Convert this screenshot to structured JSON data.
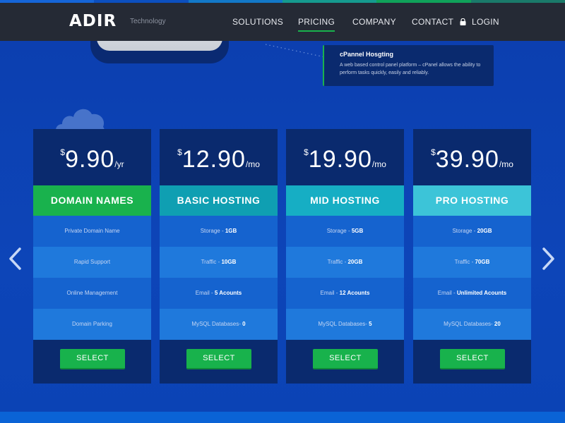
{
  "colors": {
    "accent_green": "#19b24d",
    "header_bg": "#252a35",
    "page_bg": "#0d47b8",
    "card_dark": "#0a2a6e",
    "row_light": "#1f79dc",
    "row_mid": "#1563cf",
    "top_stripe": [
      "#1565d8",
      "#0c4fbf",
      "#1278c8",
      "#159a8f",
      "#10a25a",
      "#1a7a6a"
    ]
  },
  "header": {
    "logo": "ADIR",
    "logo_sub": "Technology",
    "nav": [
      "SOLUTIONS",
      "PRICING",
      "COMPANY",
      "CONTACT"
    ],
    "active_nav": "PRICING",
    "login_label": "LOGIN"
  },
  "tooltip": {
    "title": "cPannel Hosgting",
    "body": "A web based control panel platform – cPanel allows the ability to perform tasks quickly, easily and reliably."
  },
  "carousel": {
    "prev_icon": "chevron-left-icon",
    "next_icon": "chevron-right-icon"
  },
  "plans": [
    {
      "currency": "$",
      "amount": "9.90",
      "period": "/yr",
      "name": "DOMAIN NAMES",
      "color": "#19b24d",
      "features": [
        {
          "label": "Private Domain Name",
          "value": ""
        },
        {
          "label": "Rapid Support",
          "value": ""
        },
        {
          "label": "Online Management",
          "value": ""
        },
        {
          "label": "Domain Parking",
          "value": ""
        }
      ],
      "button": "SELECT"
    },
    {
      "currency": "$",
      "amount": "12.90",
      "period": "/mo",
      "name": "BASIC HOSTING",
      "color": "#0f9fb2",
      "features": [
        {
          "label": "Storage - ",
          "value": "1GB"
        },
        {
          "label": "Traffic - ",
          "value": "10GB"
        },
        {
          "label": "Email - ",
          "value": "5 Acounts"
        },
        {
          "label": "MySQL Databases- ",
          "value": "0"
        }
      ],
      "button": "SELECT"
    },
    {
      "currency": "$",
      "amount": "19.90",
      "period": "/mo",
      "name": "MID HOSTING",
      "color": "#16aec4",
      "features": [
        {
          "label": "Storage - ",
          "value": "5GB"
        },
        {
          "label": "Traffic - ",
          "value": "20GB"
        },
        {
          "label": "Email - ",
          "value": "12 Acounts"
        },
        {
          "label": "MySQL Databases- ",
          "value": "5"
        }
      ],
      "button": "SELECT"
    },
    {
      "currency": "$",
      "amount": "39.90",
      "period": "/mo",
      "name": "PRO HOSTING",
      "color": "#3cc4d8",
      "features": [
        {
          "label": "Storage - ",
          "value": "20GB"
        },
        {
          "label": "Traffic - ",
          "value": "70GB"
        },
        {
          "label": "Email - ",
          "value": "Unlimited Acounts"
        },
        {
          "label": "MySQL Databases- ",
          "value": "20"
        }
      ],
      "button": "SELECT"
    }
  ]
}
